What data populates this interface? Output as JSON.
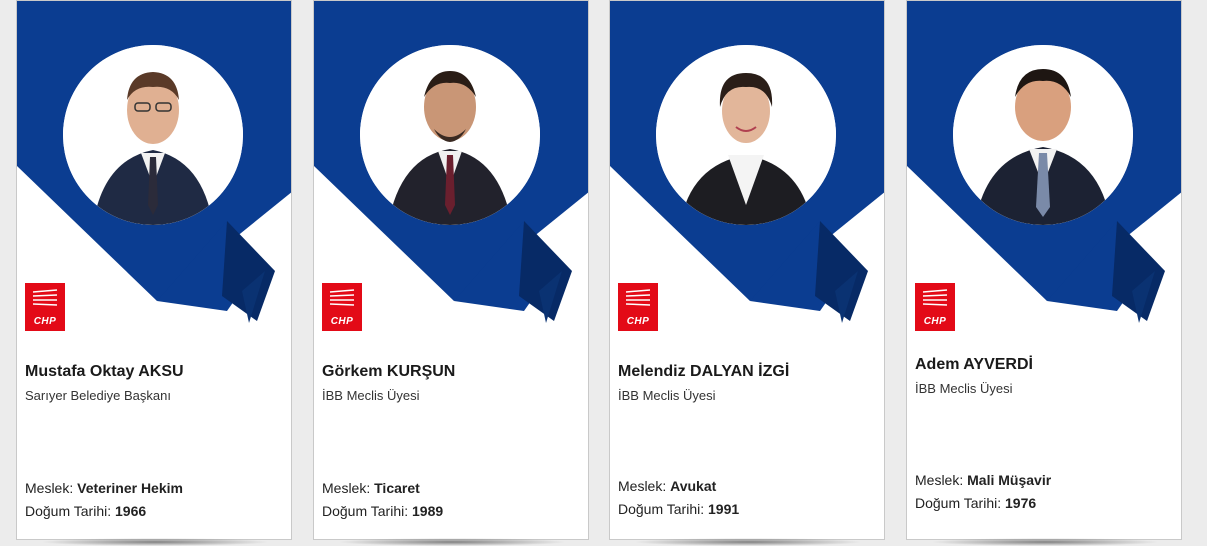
{
  "colors": {
    "banner_blue": "#0b3d91",
    "banner_dark": "#072a66",
    "party_red": "#e30a17"
  },
  "labels": {
    "profession": "Meslek:",
    "birth": "Doğum Tarihi:"
  },
  "members": [
    {
      "name": "Mustafa Oktay AKSU",
      "title": "Sarıyer Belediye Başkanı",
      "profession": "Veteriner Hekim",
      "birth_year": "1966",
      "logo_text": "CHP"
    },
    {
      "name": "Görkem KURŞUN",
      "title": "İBB Meclis Üyesi",
      "profession": "Ticaret",
      "birth_year": "1989",
      "logo_text": "CHP"
    },
    {
      "name": "Melendiz DALYAN İZGİ",
      "title": "İBB Meclis Üyesi",
      "profession": "Avukat",
      "birth_year": "1991",
      "logo_text": "CHP"
    },
    {
      "name": "Adem AYVERDİ",
      "title": "İBB Meclis Üyesi",
      "profession": "Mali Müşavir",
      "birth_year": "1976",
      "logo_text": "CHP"
    }
  ]
}
